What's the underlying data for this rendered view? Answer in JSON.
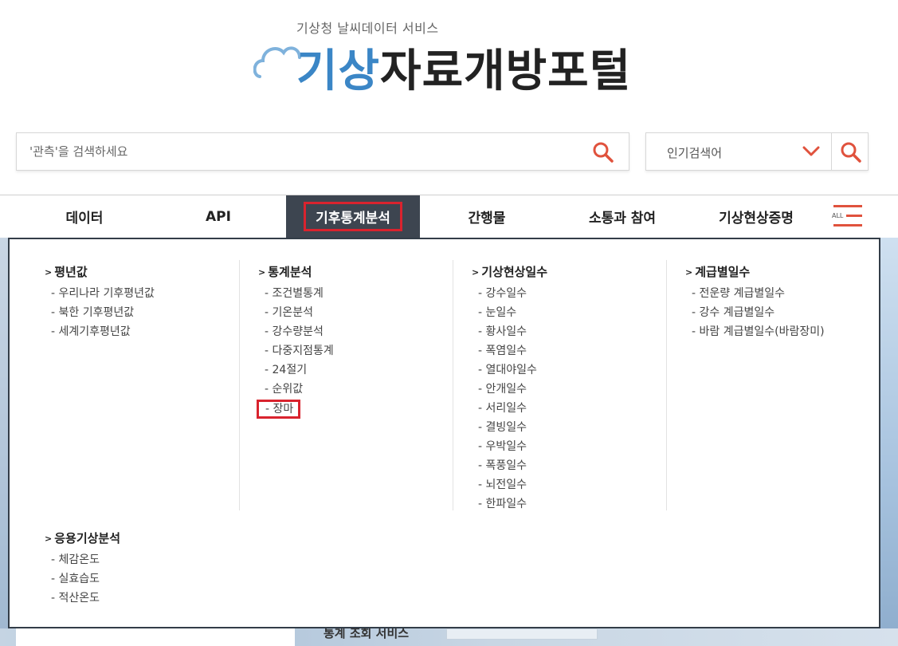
{
  "header": {
    "subtitle": "기상청 날씨데이터 서비스",
    "title_blue": "기상",
    "title_dark": "자료개방포털"
  },
  "search": {
    "placeholder": "'관측'을 검색하세요",
    "popular_label": "인기검색어"
  },
  "nav": {
    "items": [
      {
        "label": "데이터"
      },
      {
        "label": "API"
      },
      {
        "label": "기후통계분석"
      },
      {
        "label": "간행물"
      },
      {
        "label": "소통과 참여"
      },
      {
        "label": "기상현상증명"
      }
    ],
    "all_label": "ALL"
  },
  "menu": {
    "columns": [
      {
        "title": "평년값",
        "items": [
          "- 우리나라 기후평년값",
          "- 북한 기후평년값",
          "- 세계기후평년값"
        ]
      },
      {
        "title": "통계분석",
        "items": [
          "- 조건별통계",
          "- 기온분석",
          "- 강수량분석",
          "- 다중지점통계",
          "- 24절기",
          "- 순위값",
          "- 장마"
        ]
      },
      {
        "title": "기상현상일수",
        "items": [
          "- 강수일수",
          "- 눈일수",
          "- 황사일수",
          "- 폭염일수",
          "- 열대야일수",
          "- 안개일수",
          "- 서리일수",
          "- 결빙일수",
          "- 우박일수",
          "- 폭풍일수",
          "- 뇌전일수",
          "- 한파일수"
        ]
      },
      {
        "title": "계급별일수",
        "items": [
          "- 전운량 계급별일수",
          "- 강수 계급별일수",
          "- 바람 계급별일수(바람장미)"
        ]
      },
      {
        "title": "응용기상분석",
        "items": [
          "- 체감온도",
          "- 실효습도",
          "- 적산온도"
        ]
      }
    ]
  },
  "background": {
    "partial_text": "통계 조회 서비스"
  },
  "colors": {
    "accent_blue": "#3b86c6",
    "nav_active_bg": "#3d4550",
    "highlight_red": "#d9232e",
    "icon_orange": "#e0523d"
  }
}
